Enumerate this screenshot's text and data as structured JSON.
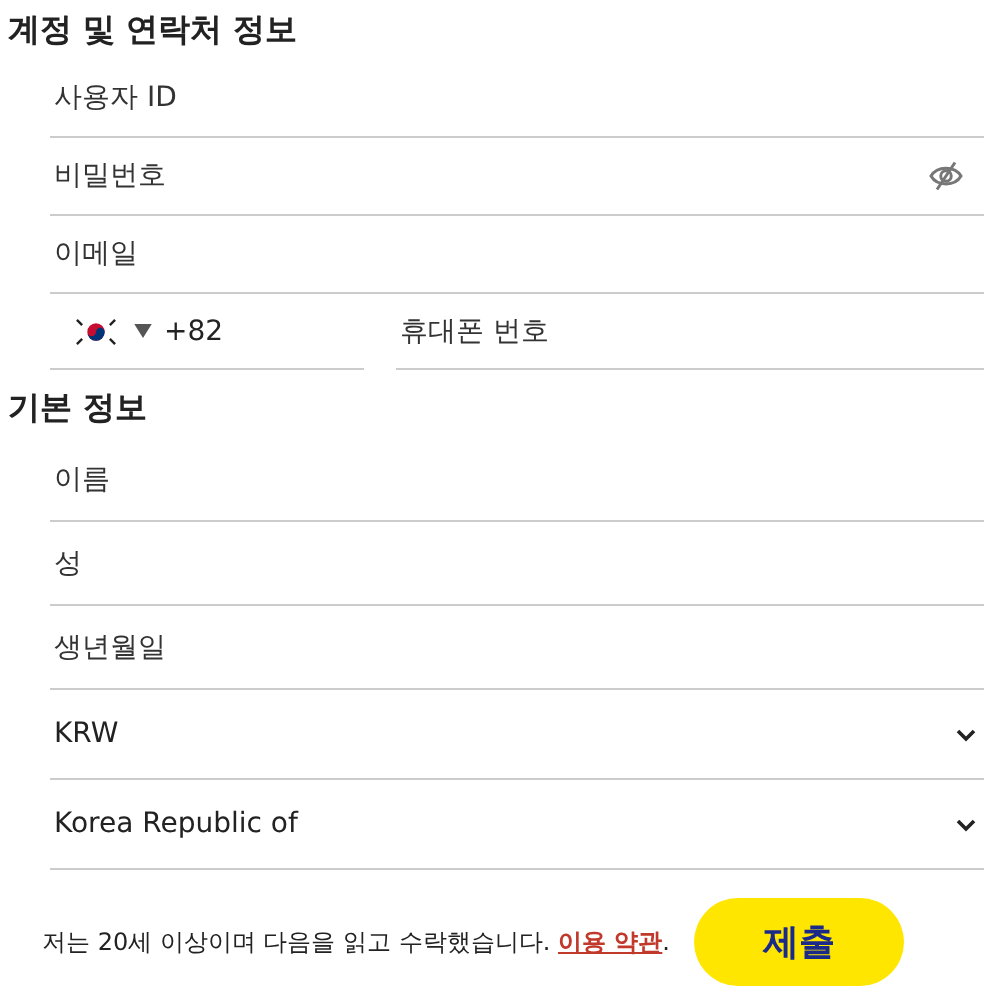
{
  "sections": [
    {
      "title": "계정 및 연락처 정보",
      "fields": [
        {
          "kind": "text",
          "placeholder": "사용자 ID"
        },
        {
          "kind": "password",
          "placeholder": "비밀번호"
        },
        {
          "kind": "text",
          "placeholder": "이메일"
        },
        {
          "kind": "phone",
          "code": "+82",
          "placeholder": "휴대폰 번호"
        }
      ]
    },
    {
      "title": "기본 정보",
      "fields": [
        {
          "kind": "text",
          "placeholder": "이름"
        },
        {
          "kind": "text",
          "placeholder": "성"
        },
        {
          "kind": "text",
          "placeholder": "생년월일"
        },
        {
          "kind": "select",
          "value": "KRW"
        },
        {
          "kind": "select",
          "value": "Korea Republic of"
        }
      ]
    }
  ],
  "agreement": {
    "text": "저는 20세 이상이며 다음을 읽고 수락했습니다. ",
    "link": "이용 약관",
    "end": "."
  },
  "submit": "제출"
}
